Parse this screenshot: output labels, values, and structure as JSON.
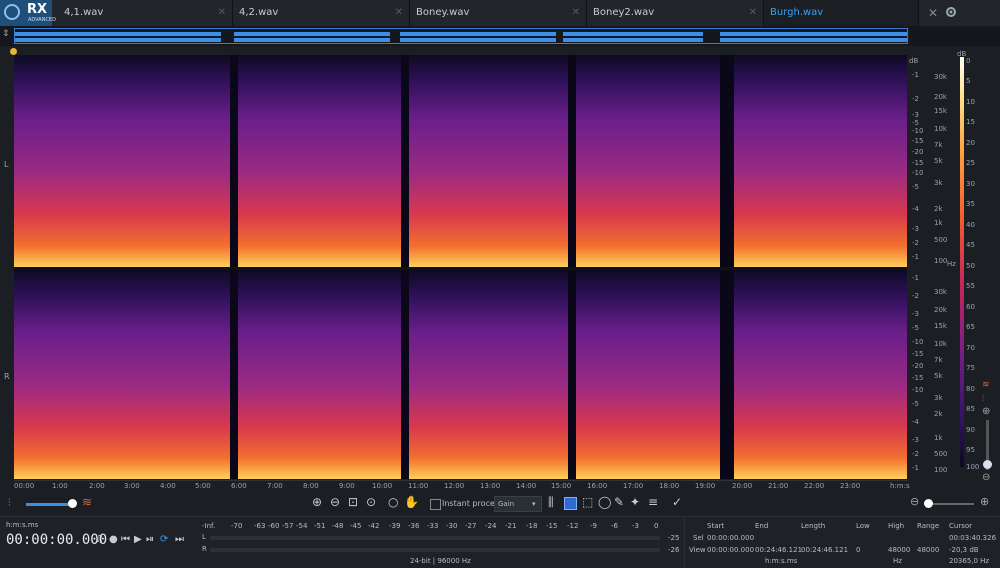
{
  "app": {
    "name": "RX",
    "edition": "ADVANCED"
  },
  "tabs": [
    {
      "label": "4,1.wav",
      "active": false
    },
    {
      "label": "4,2.wav",
      "active": false
    },
    {
      "label": "Boney.wav",
      "active": false
    },
    {
      "label": "Boney2.wav",
      "active": false
    },
    {
      "label": "Burgh.wav",
      "active": true
    }
  ],
  "channels": {
    "left": "L",
    "right": "R"
  },
  "db_axis": {
    "unit": "dB",
    "upper_ticks": [
      "-1",
      "-2",
      "-3",
      "-5",
      "-10",
      "-15",
      "-20",
      "-15",
      "-10",
      "-5",
      "-4",
      "-3",
      "-2",
      "-1"
    ],
    "lower_ticks": [
      "-1",
      "-2",
      "-3",
      "-5",
      "-10",
      "-15",
      "-20",
      "-15",
      "-10",
      "-5",
      "-4",
      "-3",
      "-2",
      "-1"
    ]
  },
  "freq_axis": {
    "upper_ticks": [
      "30k",
      "20k",
      "15k",
      "10k",
      "7k",
      "5k",
      "3k",
      "2k",
      "1k",
      "500",
      "100"
    ],
    "lower_ticks": [
      "30k",
      "20k",
      "15k",
      "10k",
      "7k",
      "5k",
      "3k",
      "2k",
      "1k",
      "500",
      "100"
    ],
    "unit": "Hz"
  },
  "colorbar": {
    "unit": "dB",
    "ticks": [
      "0",
      "5",
      "10",
      "15",
      "20",
      "25",
      "30",
      "35",
      "40",
      "45",
      "50",
      "55",
      "60",
      "65",
      "70",
      "75",
      "80",
      "85",
      "90",
      "95",
      "100"
    ]
  },
  "timeline": {
    "ticks": [
      "00:00",
      "1:00",
      "2:00",
      "3:00",
      "4:00",
      "5:00",
      "6:00",
      "7:00",
      "8:00",
      "9:00",
      "10:00",
      "11:00",
      "12:00",
      "13:00",
      "14:00",
      "15:00",
      "16:00",
      "17:00",
      "18:00",
      "19:00",
      "20:00",
      "21:00",
      "22:00",
      "23:00"
    ],
    "unit": "h:m:s"
  },
  "toolbar": {
    "instant_process_label": "Instant process",
    "gain_option": "Gain"
  },
  "transport": {
    "time_format": "h:m:s.ms",
    "time_display": "00:00:00.000"
  },
  "meter": {
    "scale": [
      "-Inf.",
      "-70",
      "-63",
      "-60",
      "-57",
      "-54",
      "-51",
      "-48",
      "-45",
      "-42",
      "-39",
      "-36",
      "-33",
      "-30",
      "-27",
      "-24",
      "-21",
      "-18",
      "-15",
      "-12",
      "-9",
      "-6",
      "-3",
      "0"
    ],
    "left_label": "L",
    "right_label": "R",
    "left_peak": "-25",
    "right_peak": "-26",
    "format": "24-bit | 96000 Hz"
  },
  "selection": {
    "headers": {
      "start": "Start",
      "end": "End",
      "length": "Length",
      "low": "Low",
      "high": "High",
      "range": "Range",
      "cursor": "Cursor"
    },
    "sel_label": "Sel",
    "view_label": "View",
    "sel_start": "00:00:00.000",
    "view_start": "00:00:00.000",
    "view_end": "00:24:46.121",
    "view_length": "00:24:46.121",
    "view_low": "0",
    "view_high": "48000",
    "view_range": "48000",
    "time_unit": "h:m:s.ms",
    "freq_unit": "Hz",
    "cursor_time": "00:03:40.326",
    "cursor_db": "-20,3 dB",
    "cursor_freq": "20365,0 Hz"
  }
}
